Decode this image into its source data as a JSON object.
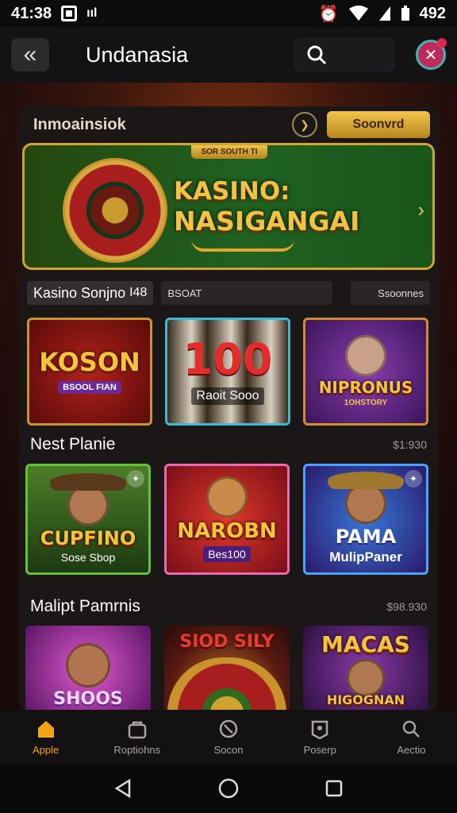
{
  "status": {
    "time": "41:38",
    "signal_text": "ııl",
    "battery": "492"
  },
  "appbar": {
    "title": "Undanasia"
  },
  "panel": {
    "title": "Inmoainsiok",
    "pill_label": "Soonvrd"
  },
  "banner": {
    "ribbon": "SOR SOUTH TI",
    "title_line1": "KASINO:",
    "title_line2": "NASIGANGAI"
  },
  "tabs": [
    "Kasino Sonjno",
    "I48",
    "BSOAT",
    "Ssoonnes"
  ],
  "row1": [
    {
      "title": "KOSON",
      "caption": "BSOOL FIAN"
    },
    {
      "title": "100",
      "caption": "Raoit Sooo"
    },
    {
      "title": "NIPRONUS",
      "caption": "1OHSTORY"
    }
  ],
  "section2": {
    "title": "Nest Planie",
    "value": "$1:930"
  },
  "row2": [
    {
      "title": "CUPFINO",
      "caption": "Sose Sbop"
    },
    {
      "title": "NAROBN",
      "caption": "Bes100"
    },
    {
      "title": "PAMA",
      "caption": "MulipPaner"
    }
  ],
  "section3": {
    "title": "Malipt Pamrnis",
    "value": "$98.930"
  },
  "row3": [
    {
      "title": "SHOOS"
    },
    {
      "title": "SIOD SILY"
    },
    {
      "title": "MACAS",
      "sub": "HIGOGNAN"
    }
  ],
  "nav": [
    {
      "label": "Apple",
      "icon": "home-icon",
      "active": true
    },
    {
      "label": "Roptiohns",
      "icon": "bag-icon"
    },
    {
      "label": "Socon",
      "icon": "globe-icon"
    },
    {
      "label": "Poserp",
      "icon": "user-icon"
    },
    {
      "label": "Aectio",
      "icon": "search-icon"
    }
  ],
  "colors": {
    "accent": "#f2a414",
    "gold": "#f2c247",
    "panel": "#1b1716"
  }
}
